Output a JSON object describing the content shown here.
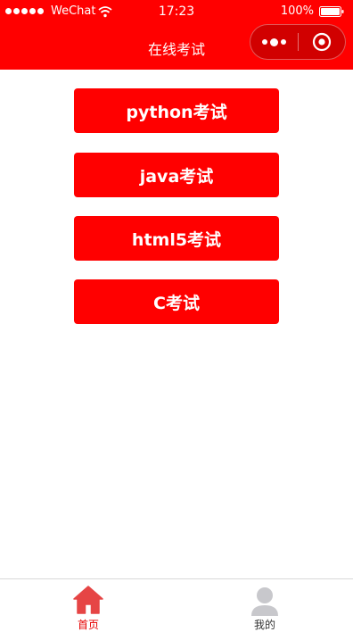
{
  "status_bar": {
    "carrier": "WeChat",
    "time": "17:23",
    "battery": "100%"
  },
  "nav": {
    "title": "在线考试"
  },
  "buttons": [
    {
      "label": "python考试"
    },
    {
      "label": "java考试"
    },
    {
      "label": "html5考试"
    },
    {
      "label": "C考试"
    }
  ],
  "tabbar": {
    "items": [
      {
        "label": "首页",
        "icon": "home-icon",
        "active": true
      },
      {
        "label": "我的",
        "icon": "user-icon",
        "active": false
      }
    ]
  },
  "colors": {
    "brand": "#ff0000",
    "active_tab": "#e60000",
    "inactive_icon": "#c8c8cc"
  }
}
